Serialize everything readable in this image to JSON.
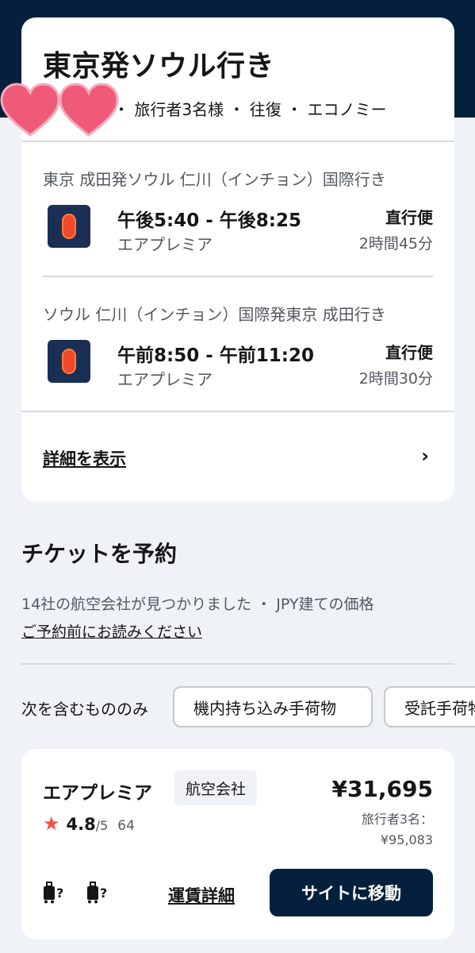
{
  "summary": {
    "title": "東京発ソウル行き",
    "subtitle": "・ 旅行者3名様 ・ 往復 ・ エコノミー",
    "legs": [
      {
        "route": "東京 成田発ソウル 仁川（インチョン）国際行き",
        "times": "午後5:40 - 午後8:25",
        "airline": "エアプレミア",
        "stops": "直行便",
        "duration": "2時間45分"
      },
      {
        "route": "ソウル 仁川（インチョン）国際発東京 成田行き",
        "times": "午前8:50 - 午前11:20",
        "airline": "エアプレミア",
        "stops": "直行便",
        "duration": "2時間30分"
      }
    ],
    "details_link": "詳細を表示",
    "chevron": "›"
  },
  "booking": {
    "title": "チケットを予約",
    "found_text": "14社の航空会社が見つかりました ・ JPY建ての価格",
    "notice_link": "ご予約前にお読みください"
  },
  "filters": {
    "label": "次を含むもののみ",
    "chips": [
      "機内持ち込み手荷物",
      "受託手荷物"
    ]
  },
  "deal": {
    "airline": "エアプレミア",
    "tag": "航空会社",
    "price": "¥31,695",
    "travelers_label": "旅行者3名：",
    "total_price": "¥95,083",
    "rating": "4.8",
    "rating_max": "/5",
    "rating_count": "64",
    "bag_unknown": "?",
    "fare_details": "運賃詳細",
    "go_button": "サイトに移動"
  },
  "colors": {
    "header_navy": "#05203c",
    "logo_navy": "#1b2f55",
    "logo_orange": "#f0492a",
    "star": "#f1523f",
    "heart_pink": "#ee5a78"
  }
}
